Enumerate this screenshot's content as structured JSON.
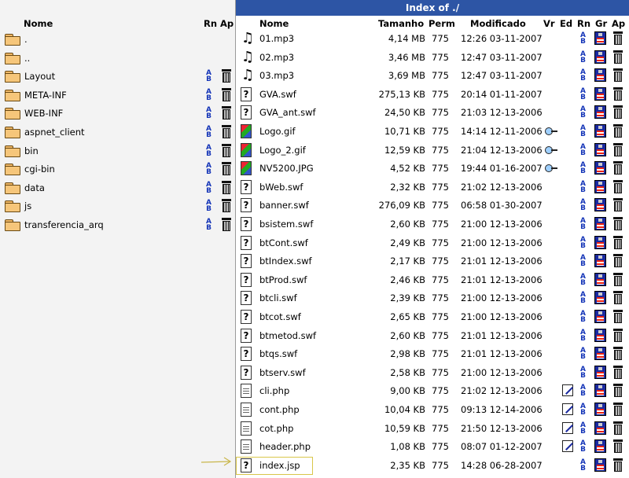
{
  "title": "Index of ./",
  "left_headers": {
    "name": "Nome",
    "rn": "Rn",
    "ap": "Ap"
  },
  "right_headers": {
    "name": "Nome",
    "size": "Tamanho",
    "perm": "Perm",
    "modified": "Modificado",
    "vr": "Vr",
    "ed": "Ed",
    "rn": "Rn",
    "gr": "Gr",
    "ap": "Ap"
  },
  "folders": [
    {
      "name": ".",
      "actions": false
    },
    {
      "name": "..",
      "actions": false
    },
    {
      "name": "Layout",
      "actions": true
    },
    {
      "name": "META-INF",
      "actions": true
    },
    {
      "name": "WEB-INF",
      "actions": true
    },
    {
      "name": "aspnet_client",
      "actions": true
    },
    {
      "name": "bin",
      "actions": true
    },
    {
      "name": "cgi-bin",
      "actions": true
    },
    {
      "name": "data",
      "actions": true
    },
    {
      "name": "js",
      "actions": true
    },
    {
      "name": "transferencia_arq",
      "actions": true
    }
  ],
  "files": [
    {
      "name": "01.mp3",
      "icon": "music-icon",
      "size": "4,14 MB",
      "perm": "775",
      "modified": "12:26 03-11-2007",
      "view": false,
      "edit": false
    },
    {
      "name": "02.mp3",
      "icon": "music-icon",
      "size": "3,46 MB",
      "perm": "775",
      "modified": "12:47 03-11-2007",
      "view": false,
      "edit": false
    },
    {
      "name": "03.mp3",
      "icon": "music-icon",
      "size": "3,69 MB",
      "perm": "775",
      "modified": "12:47 03-11-2007",
      "view": false,
      "edit": false
    },
    {
      "name": "GVA.swf",
      "icon": "unknown-file-icon",
      "size": "275,13 KB",
      "perm": "775",
      "modified": "20:14 01-11-2007",
      "view": false,
      "edit": false
    },
    {
      "name": "GVA_ant.swf",
      "icon": "unknown-file-icon",
      "size": "24,50 KB",
      "perm": "775",
      "modified": "21:03 12-13-2006",
      "view": false,
      "edit": false
    },
    {
      "name": "Logo.gif",
      "icon": "image-file-icon",
      "size": "10,71 KB",
      "perm": "775",
      "modified": "14:14 12-11-2006",
      "view": true,
      "edit": false
    },
    {
      "name": "Logo_2.gif",
      "icon": "image-file-icon",
      "size": "12,59 KB",
      "perm": "775",
      "modified": "21:04 12-13-2006",
      "view": true,
      "edit": false
    },
    {
      "name": "NV5200.JPG",
      "icon": "image-file-icon",
      "size": "4,52 KB",
      "perm": "775",
      "modified": "19:44 01-16-2007",
      "view": true,
      "edit": false
    },
    {
      "name": "bWeb.swf",
      "icon": "unknown-file-icon",
      "size": "2,32 KB",
      "perm": "775",
      "modified": "21:02 12-13-2006",
      "view": false,
      "edit": false
    },
    {
      "name": "banner.swf",
      "icon": "unknown-file-icon",
      "size": "276,09 KB",
      "perm": "775",
      "modified": "06:58 01-30-2007",
      "view": false,
      "edit": false
    },
    {
      "name": "bsistem.swf",
      "icon": "unknown-file-icon",
      "size": "2,60 KB",
      "perm": "775",
      "modified": "21:00 12-13-2006",
      "view": false,
      "edit": false
    },
    {
      "name": "btCont.swf",
      "icon": "unknown-file-icon",
      "size": "2,49 KB",
      "perm": "775",
      "modified": "21:00 12-13-2006",
      "view": false,
      "edit": false
    },
    {
      "name": "btIndex.swf",
      "icon": "unknown-file-icon",
      "size": "2,17 KB",
      "perm": "775",
      "modified": "21:01 12-13-2006",
      "view": false,
      "edit": false
    },
    {
      "name": "btProd.swf",
      "icon": "unknown-file-icon",
      "size": "2,46 KB",
      "perm": "775",
      "modified": "21:01 12-13-2006",
      "view": false,
      "edit": false
    },
    {
      "name": "btcli.swf",
      "icon": "unknown-file-icon",
      "size": "2,39 KB",
      "perm": "775",
      "modified": "21:00 12-13-2006",
      "view": false,
      "edit": false
    },
    {
      "name": "btcot.swf",
      "icon": "unknown-file-icon",
      "size": "2,65 KB",
      "perm": "775",
      "modified": "21:00 12-13-2006",
      "view": false,
      "edit": false
    },
    {
      "name": "btmetod.swf",
      "icon": "unknown-file-icon",
      "size": "2,60 KB",
      "perm": "775",
      "modified": "21:01 12-13-2006",
      "view": false,
      "edit": false
    },
    {
      "name": "btqs.swf",
      "icon": "unknown-file-icon",
      "size": "2,98 KB",
      "perm": "775",
      "modified": "21:01 12-13-2006",
      "view": false,
      "edit": false
    },
    {
      "name": "btserv.swf",
      "icon": "unknown-file-icon",
      "size": "2,58 KB",
      "perm": "775",
      "modified": "21:00 12-13-2006",
      "view": false,
      "edit": false
    },
    {
      "name": "cli.php",
      "icon": "text-file-icon",
      "size": "9,00 KB",
      "perm": "775",
      "modified": "21:02 12-13-2006",
      "view": false,
      "edit": true
    },
    {
      "name": "cont.php",
      "icon": "text-file-icon",
      "size": "10,04 KB",
      "perm": "775",
      "modified": "09:13 12-14-2006",
      "view": false,
      "edit": true
    },
    {
      "name": "cot.php",
      "icon": "text-file-icon",
      "size": "10,59 KB",
      "perm": "775",
      "modified": "21:50 12-13-2006",
      "view": false,
      "edit": true
    },
    {
      "name": "header.php",
      "icon": "text-file-icon",
      "size": "1,08 KB",
      "perm": "775",
      "modified": "08:07 01-12-2007",
      "view": false,
      "edit": true
    },
    {
      "name": "index.jsp",
      "icon": "unknown-file-icon",
      "size": "2,35 KB",
      "perm": "775",
      "modified": "14:28 06-28-2007",
      "view": false,
      "edit": false
    }
  ],
  "colors": {
    "titlebar": "#2d55a5",
    "left_panel": "#f3f3f3",
    "highlight_box": "#d9c64a"
  }
}
